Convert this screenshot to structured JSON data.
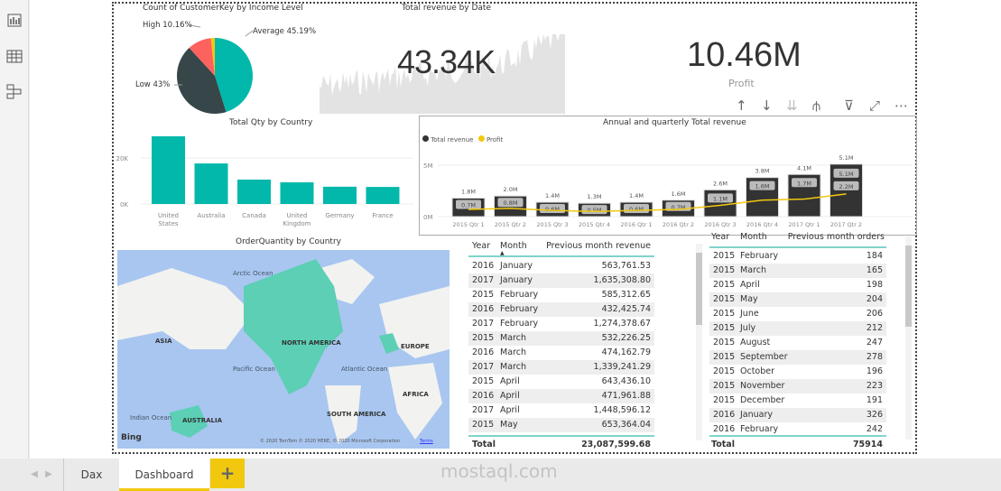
{
  "sidebar": {
    "items": [
      {
        "icon": "report-view-icon"
      },
      {
        "icon": "data-view-icon"
      },
      {
        "icon": "model-view-icon"
      }
    ]
  },
  "pie": {
    "title": "Count of CustomerKey by Income Level",
    "chart_data": {
      "type": "pie",
      "slices": [
        {
          "label": "Average",
          "value": 45.19,
          "color": "#01b8aa"
        },
        {
          "label": "Low",
          "value": 43,
          "color": "#374649"
        },
        {
          "label": "High",
          "value": 10.16,
          "color": "#fd625e"
        },
        {
          "label": "",
          "value": 1.65,
          "color": "#f2c80f"
        }
      ]
    },
    "labels": {
      "average": "Average 45.19%",
      "low": "Low 43%",
      "high": "High 10.16%"
    }
  },
  "kpi_revenue": {
    "title": "Total revenue by Date",
    "value": "43.34K"
  },
  "kpi_profit": {
    "value": "10.46M",
    "label": "Profit"
  },
  "visual_toolbar": {
    "icons": [
      "drill-up-icon",
      "drill-down-icon",
      "expand-all-icon",
      "expand-hierarchy-icon",
      "filter-icon",
      "focus-mode-icon",
      "more-options-icon"
    ]
  },
  "qty_chart": {
    "chart_data": {
      "type": "bar",
      "title": "Total Qty by Country",
      "categories": [
        "United States",
        "Australia",
        "Canada",
        "United Kingdom",
        "Germany",
        "France"
      ],
      "values": [
        29400,
        17600,
        10600,
        9400,
        7500,
        7400
      ],
      "yticks": [
        "0K",
        "20K"
      ],
      "ylim": [
        0,
        30000
      ],
      "color": "#01b8aa"
    }
  },
  "combo_chart": {
    "chart_data": {
      "type": "bar",
      "title": "Annual and quarterly Total revenue",
      "categories": [
        "2015 Qtr 1",
        "2015 Qtr 2",
        "2015 Qtr 3",
        "2015 Qtr 4",
        "2016 Qtr 1",
        "2016 Qtr 2",
        "2016 Qtr 3",
        "2016 Qtr 4",
        "2017 Qtr 1",
        "2017 Qtr 2"
      ],
      "series": [
        {
          "name": "Total revenue",
          "type": "bar",
          "color": "#333333",
          "values": [
            1.8,
            2.0,
            1.4,
            1.3,
            1.4,
            1.6,
            2.6,
            3.8,
            4.1,
            5.1
          ],
          "labels": [
            "1.8M",
            "2.0M",
            "1.4M",
            "1.3M",
            "1.4M",
            "1.6M",
            "2.6M",
            "3.8M",
            "4.1M",
            "5.1M"
          ]
        },
        {
          "name": "Profit",
          "type": "line",
          "color": "#f2c80f",
          "values": [
            0.7,
            0.8,
            0.6,
            0.5,
            0.6,
            0.7,
            1.1,
            1.6,
            1.7,
            2.2
          ],
          "labels": [
            "0.7M",
            "0.8M",
            "0.6M",
            "0.5M",
            "0.6M",
            "0.7M",
            "1.1M",
            "1.6M",
            "1.7M",
            "2.2M"
          ]
        }
      ],
      "yticks": [
        "0M",
        "5M"
      ],
      "ylim": [
        0,
        5
      ],
      "legend": "top-left"
    }
  },
  "map": {
    "title": "OrderQuantity by Country",
    "labels": [
      "Arctic Ocean",
      "ASIA",
      "NORTH AMERICA",
      "EUROPE",
      "Pacific Ocean",
      "Atlantic Ocean",
      "AFRICA",
      "Indian Ocean",
      "AUSTRALIA",
      "SOUTH AMERICA"
    ],
    "bing": "Bing",
    "copyright": "© 2020 TomTom © 2020 HERE, © 2020 Microsoft Corporation",
    "terms": "Terms"
  },
  "table_revenue": {
    "headers": [
      "Year",
      "Month",
      "Previous month revenue"
    ],
    "rows": [
      [
        "2016",
        "January",
        "563,761.53"
      ],
      [
        "2017",
        "January",
        "1,635,308.80"
      ],
      [
        "2015",
        "February",
        "585,312.65"
      ],
      [
        "2016",
        "February",
        "432,425.74"
      ],
      [
        "2017",
        "February",
        "1,274,378.67"
      ],
      [
        "2015",
        "March",
        "532,226.25"
      ],
      [
        "2016",
        "March",
        "474,162.79"
      ],
      [
        "2017",
        "March",
        "1,339,241.29"
      ],
      [
        "2015",
        "April",
        "643,436.10"
      ],
      [
        "2016",
        "April",
        "471,961.88"
      ],
      [
        "2017",
        "April",
        "1,448,596.12"
      ],
      [
        "2015",
        "May",
        "653,364.04"
      ]
    ],
    "total_label": "Total",
    "total": "23,087,599.68"
  },
  "table_orders": {
    "headers": [
      "Year",
      "Month",
      "Previous month orders"
    ],
    "rows": [
      [
        "2015",
        "February",
        "184"
      ],
      [
        "2015",
        "March",
        "165"
      ],
      [
        "2015",
        "April",
        "198"
      ],
      [
        "2015",
        "May",
        "204"
      ],
      [
        "2015",
        "June",
        "206"
      ],
      [
        "2015",
        "July",
        "212"
      ],
      [
        "2015",
        "August",
        "247"
      ],
      [
        "2015",
        "September",
        "278"
      ],
      [
        "2015",
        "October",
        "196"
      ],
      [
        "2015",
        "November",
        "223"
      ],
      [
        "2015",
        "December",
        "191"
      ],
      [
        "2016",
        "January",
        "326"
      ],
      [
        "2016",
        "February",
        "242"
      ]
    ],
    "total_label": "Total",
    "total": "75914"
  },
  "tabs": {
    "items": [
      {
        "label": "Dax"
      },
      {
        "label": "Dashboard",
        "active": true
      }
    ],
    "add": "+"
  },
  "watermark": "mostaql.com",
  "colors": {
    "accent": "#f2c80f",
    "teal": "#01b8aa"
  }
}
